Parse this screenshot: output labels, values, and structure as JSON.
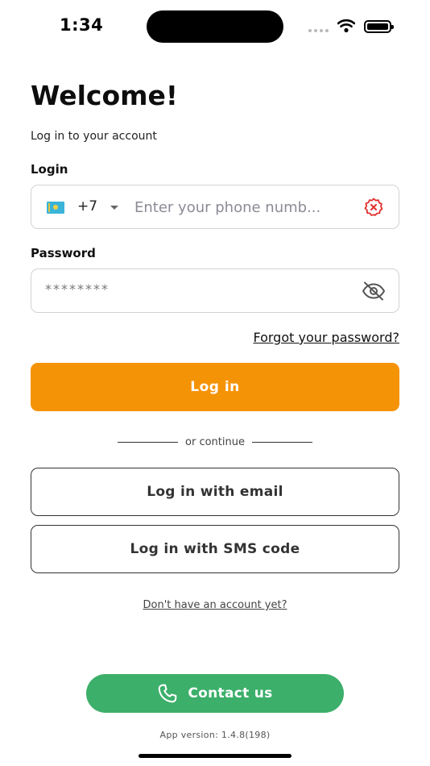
{
  "status_bar": {
    "time": "1:34"
  },
  "header": {
    "title": "Welcome!",
    "subtitle": "Log in to your account"
  },
  "login": {
    "label": "Login",
    "country_code": "+7",
    "phone_placeholder": "Enter your phone numb..."
  },
  "password": {
    "label": "Password",
    "value": "********"
  },
  "forgot_label": "Forgot your password?",
  "login_button": "Log in",
  "divider_text": "or continue",
  "email_button": "Log in with email",
  "sms_button": "Log in with SMS code",
  "signup_link": "Don't have an account yet?",
  "contact_button": "Contact us",
  "app_version": "App version: 1.4.8(198)",
  "colors": {
    "primary": "#f59307",
    "contact": "#3caf6a",
    "error": "#e0312e"
  },
  "icons": {
    "flag": "kazakhstan-flag-icon",
    "clear": "clear-error-icon",
    "visibility": "eye-off-icon",
    "phone": "phone-icon"
  }
}
